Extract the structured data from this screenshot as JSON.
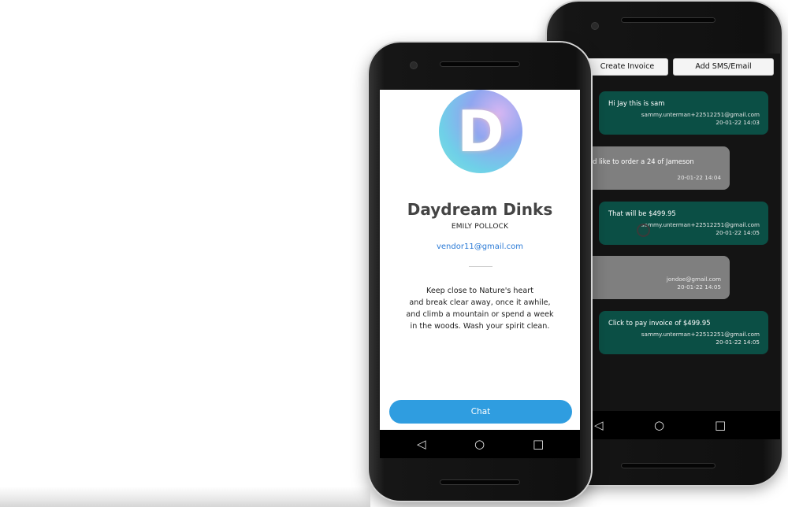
{
  "chat_phone": {
    "buttons": {
      "create_invoice": "Create Invoice",
      "add_sms_email": "Add SMS/Email"
    },
    "messages": [
      {
        "direction": "outgoing",
        "text": "Hi Jay this is sam",
        "sender": "sammy.unterman+22512251@gmail.com",
        "timestamp": "20-01-22 14:03"
      },
      {
        "direction": "incoming",
        "text": ", I'd like to order a 24 of Jameson",
        "sender": "",
        "timestamp": "20-01-22 14:04"
      },
      {
        "direction": "outgoing",
        "text": "That will be $499.95",
        "sender": "sammy.unterman+22512251@gmail.com",
        "timestamp": "20-01-22 14:05"
      },
      {
        "direction": "incoming",
        "text": "",
        "sender": "jondoe@gmail.com",
        "timestamp": "20-01-22 14:05"
      },
      {
        "direction": "outgoing",
        "text": "Click to pay invoice of $499.95",
        "sender": "sammy.unterman+22512251@gmail.com",
        "timestamp": "20-01-22 14:05"
      }
    ],
    "nav": {
      "back": "◁",
      "home": "○",
      "recents": "□"
    }
  },
  "profile_phone": {
    "avatar_letter": "D",
    "business_name": "Daydream Dinks",
    "owner_name": "EMILY POLLOCK",
    "email": "vendor11@gmail.com",
    "quote_lines": [
      "Keep close to Nature's heart",
      "and break clear away, once it awhile,",
      "and climb a mountain or spend a week",
      "in the woods. Wash your spirit clean."
    ],
    "chat_button": "Chat",
    "nav": {
      "back": "◁",
      "home": "○",
      "recents": "□"
    }
  },
  "colors": {
    "outgoing_bubble": "#0b4f45",
    "incoming_bubble": "#7f7f7f",
    "chat_button": "#2f9de0",
    "email_link": "#2a7ad6"
  }
}
